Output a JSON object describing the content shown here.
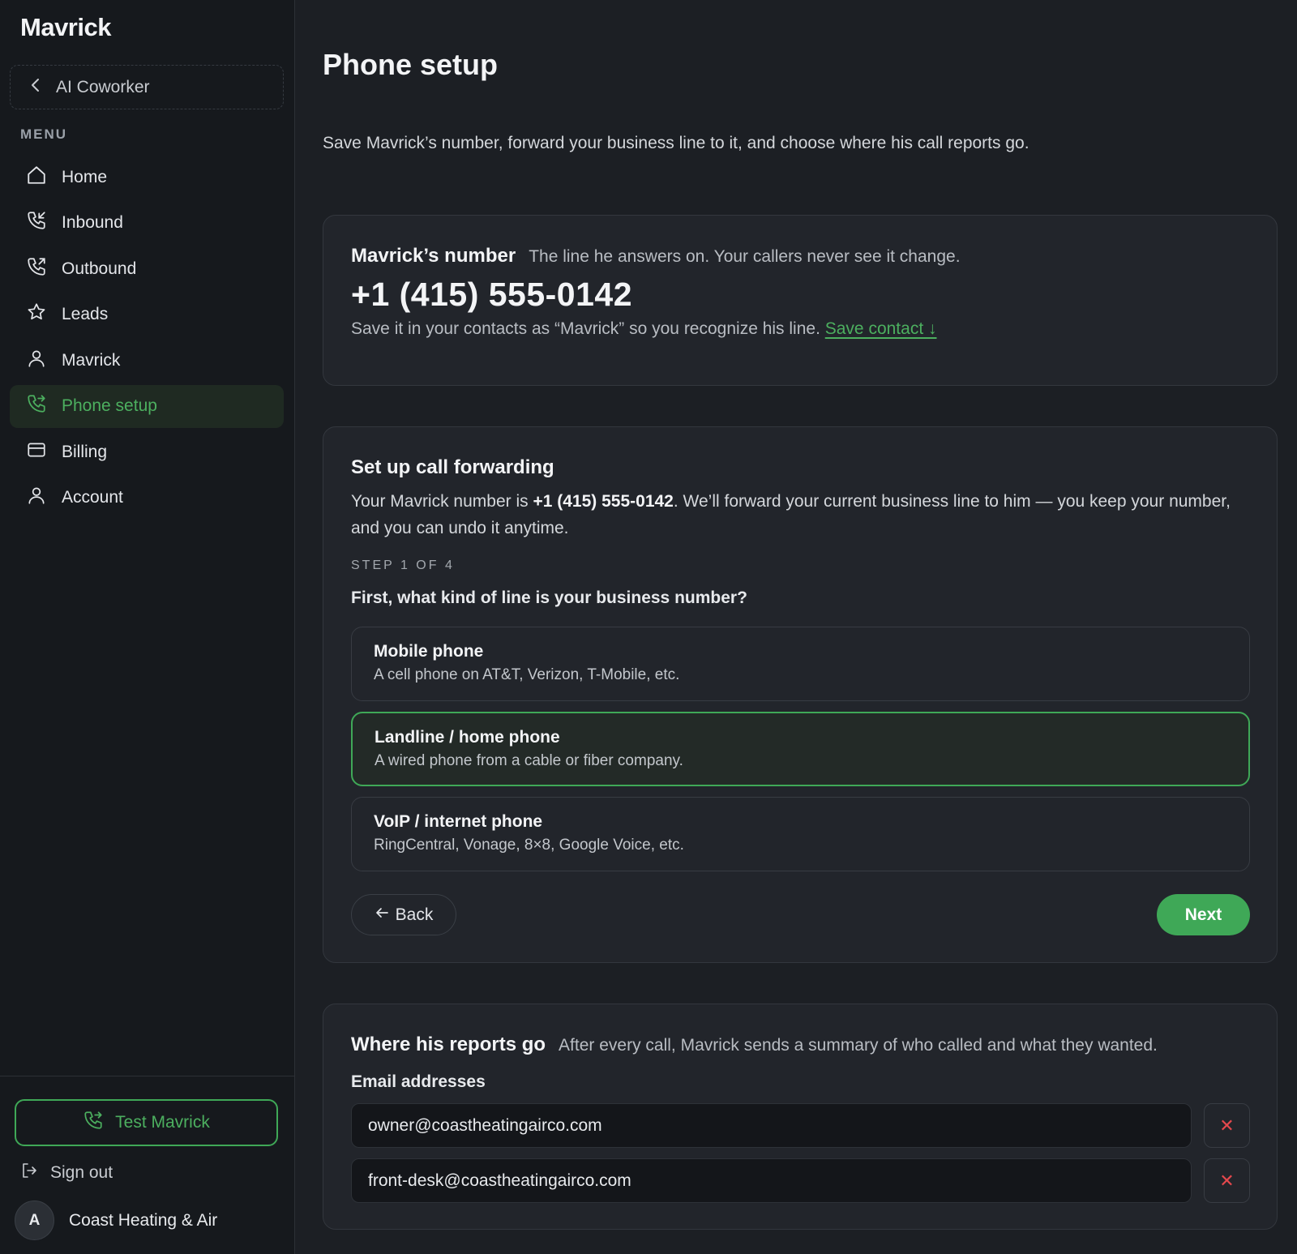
{
  "app": {
    "brand": "Mavrick"
  },
  "sidebar": {
    "back_label": "AI Coworker",
    "menu_label": "MENU",
    "items": [
      {
        "label": "Home",
        "icon": "home-icon"
      },
      {
        "label": "Inbound",
        "icon": "phone-incoming-icon"
      },
      {
        "label": "Outbound",
        "icon": "phone-outgoing-icon"
      },
      {
        "label": "Leads",
        "icon": "star-icon"
      },
      {
        "label": "Mavrick",
        "icon": "user-icon"
      },
      {
        "label": "Phone setup",
        "icon": "phone-forward-icon",
        "active": true
      },
      {
        "label": "Billing",
        "icon": "credit-card-icon"
      },
      {
        "label": "Account",
        "icon": "user-icon"
      }
    ],
    "test_button": "Test Mavrick",
    "sign_out": "Sign out",
    "account": {
      "initial": "A",
      "name": "Coast Heating & Air"
    }
  },
  "page": {
    "title": "Phone setup",
    "subtitle": "Save Mavrick’s number, forward your business line to it, and choose where his call reports go."
  },
  "number_card": {
    "heading": "Mavrick’s number",
    "description": "The line he answers on. Your callers never see it change.",
    "number": "+1 (415) 555-0142",
    "save_text": "Save it in your contacts as “Mavrick” so you recognize his line.",
    "save_link": "Save contact ↓"
  },
  "forwarding": {
    "title": "Set up call forwarding",
    "desc_prefix": "Your Mavrick number is ",
    "desc_number": "+1 (415) 555-0142",
    "desc_suffix": ". We’ll forward your current business line to him — you keep your number, and you can undo it anytime.",
    "step": "STEP 1 OF 4",
    "question": "First, what kind of line is your business number?",
    "options": [
      {
        "title": "Mobile phone",
        "subtitle": "A cell phone on AT&T, Verizon, T-Mobile, etc."
      },
      {
        "title": "Landline / home phone",
        "subtitle": "A wired phone from a cable or fiber company.",
        "selected": true
      },
      {
        "title": "VoIP / internet phone",
        "subtitle": "RingCentral, Vonage, 8×8, Google Voice, etc."
      }
    ],
    "back": "Back",
    "next": "Next"
  },
  "reports": {
    "heading": "Where his reports go",
    "description": "After every call, Mavrick sends a summary of who called and what they wanted.",
    "email_label": "Email addresses",
    "emails": [
      "owner@coastheatingairco.com",
      "front-desk@coastheatingairco.com"
    ]
  },
  "colors": {
    "accent": "#3fa857",
    "accent_text": "#4caf5f",
    "danger": "#e5484d",
    "background": "#1c1f24",
    "sidebar": "#16191d",
    "card": "#22252b"
  }
}
